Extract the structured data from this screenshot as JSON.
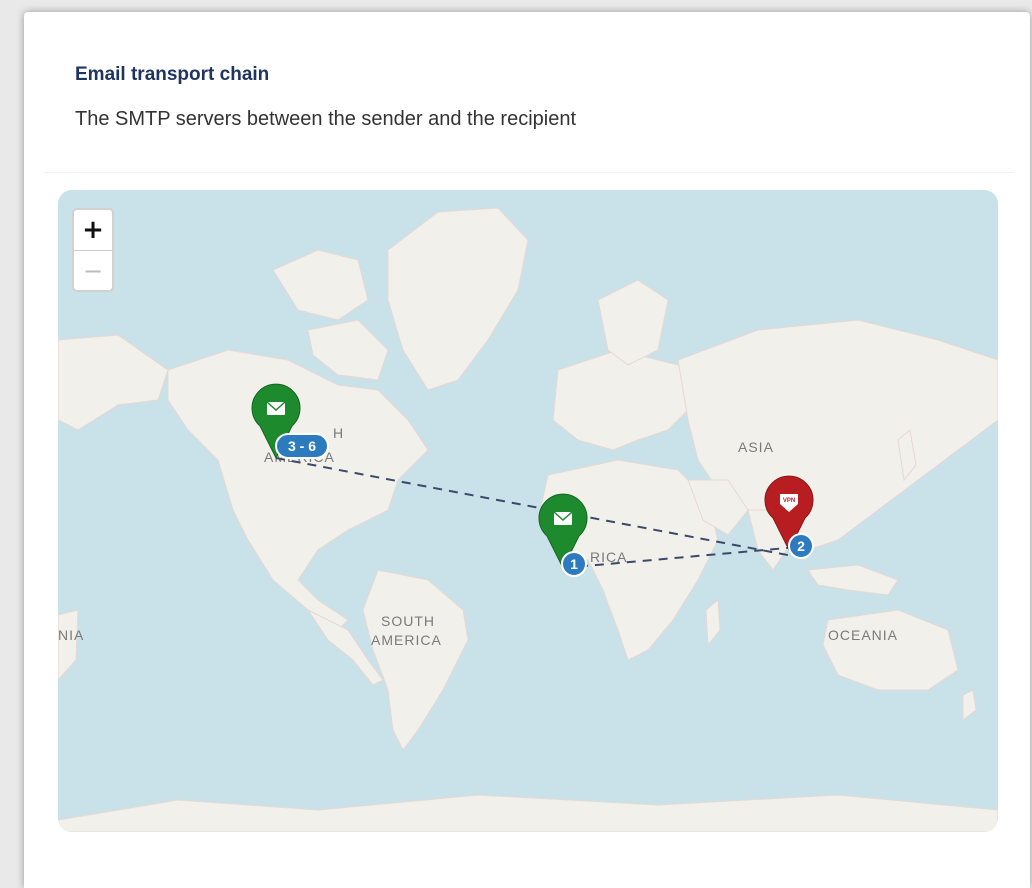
{
  "card": {
    "title": "Email transport chain",
    "subtitle": "The SMTP servers between the sender and the recipient"
  },
  "map": {
    "zoom_in_label": "+",
    "zoom_out_label": "−",
    "continent_labels": {
      "north_america": "AMERICA",
      "north_america_fragment": "H",
      "asia": "ASIA",
      "africa": "RICA",
      "south_america_line1": "SOUTH",
      "south_america_line2": "AMERICA",
      "oceania": "OCEANIA",
      "left_edge": "NIA"
    },
    "markers": [
      {
        "id": "north-america",
        "color": "#1e8a2e",
        "icon": "envelope-icon",
        "badge": "3 - 6",
        "badge_color": "#2c7bbf"
      },
      {
        "id": "africa",
        "color": "#1e8a2e",
        "icon": "envelope-icon",
        "badge": "1",
        "badge_color": "#2c7bbf"
      },
      {
        "id": "asia",
        "color": "#b81d22",
        "icon": "vpn-icon",
        "icon_text": "VPN",
        "badge": "2",
        "badge_color": "#2c7bbf"
      }
    ],
    "colors": {
      "ocean": "#c9e1e8",
      "land": "#f2f0ea",
      "route_line": "#3a4a6a"
    }
  }
}
